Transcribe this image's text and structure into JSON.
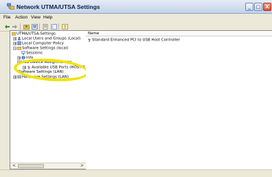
{
  "window": {
    "title": "Network UTMA/UTSA Settings",
    "controls": {
      "minimize": "_",
      "maximize": "□",
      "close": "X"
    }
  },
  "menubar": {
    "items": [
      "File",
      "Action",
      "View",
      "Help"
    ]
  },
  "toolbar": {
    "buttons": [
      "back-arrow-icon",
      "forward-arrow-icon",
      "up-folder-icon",
      "properties-icon",
      "export-list-icon",
      "show-hide-tree-icon",
      "help-icon"
    ]
  },
  "tree": {
    "items": [
      {
        "label": "UTMA/UTSA-Settings",
        "expander": ""
      },
      {
        "label": "Local Users and Groups (Local)",
        "expander": "+"
      },
      {
        "label": "Local Computer Policy",
        "expander": "+"
      },
      {
        "label": "Software Settings (local)",
        "expander": "−"
      },
      {
        "label": "Sessions",
        "expander": ""
      },
      {
        "label": "Info",
        "expander": "+"
      },
      {
        "label": "USB Device Assignment(s)",
        "expander": "−"
      },
      {
        "label": "Available USB Ports (HOST-P",
        "expander": "+"
      },
      {
        "label": "Software Settings (LAN)",
        "expander": ""
      },
      {
        "label": "Hardware Settings (LAN)",
        "expander": "+"
      }
    ]
  },
  "list": {
    "column_name": "Name",
    "rows": [
      "Standard Enhanced PCI to USB Host Controller"
    ]
  },
  "scrollbar": {
    "left_arrow": "<",
    "right_arrow": ">"
  },
  "colors": {
    "highlight": "#f2e300",
    "title_bar": "#c4d3ea",
    "window_bg": "#ece9d8"
  }
}
